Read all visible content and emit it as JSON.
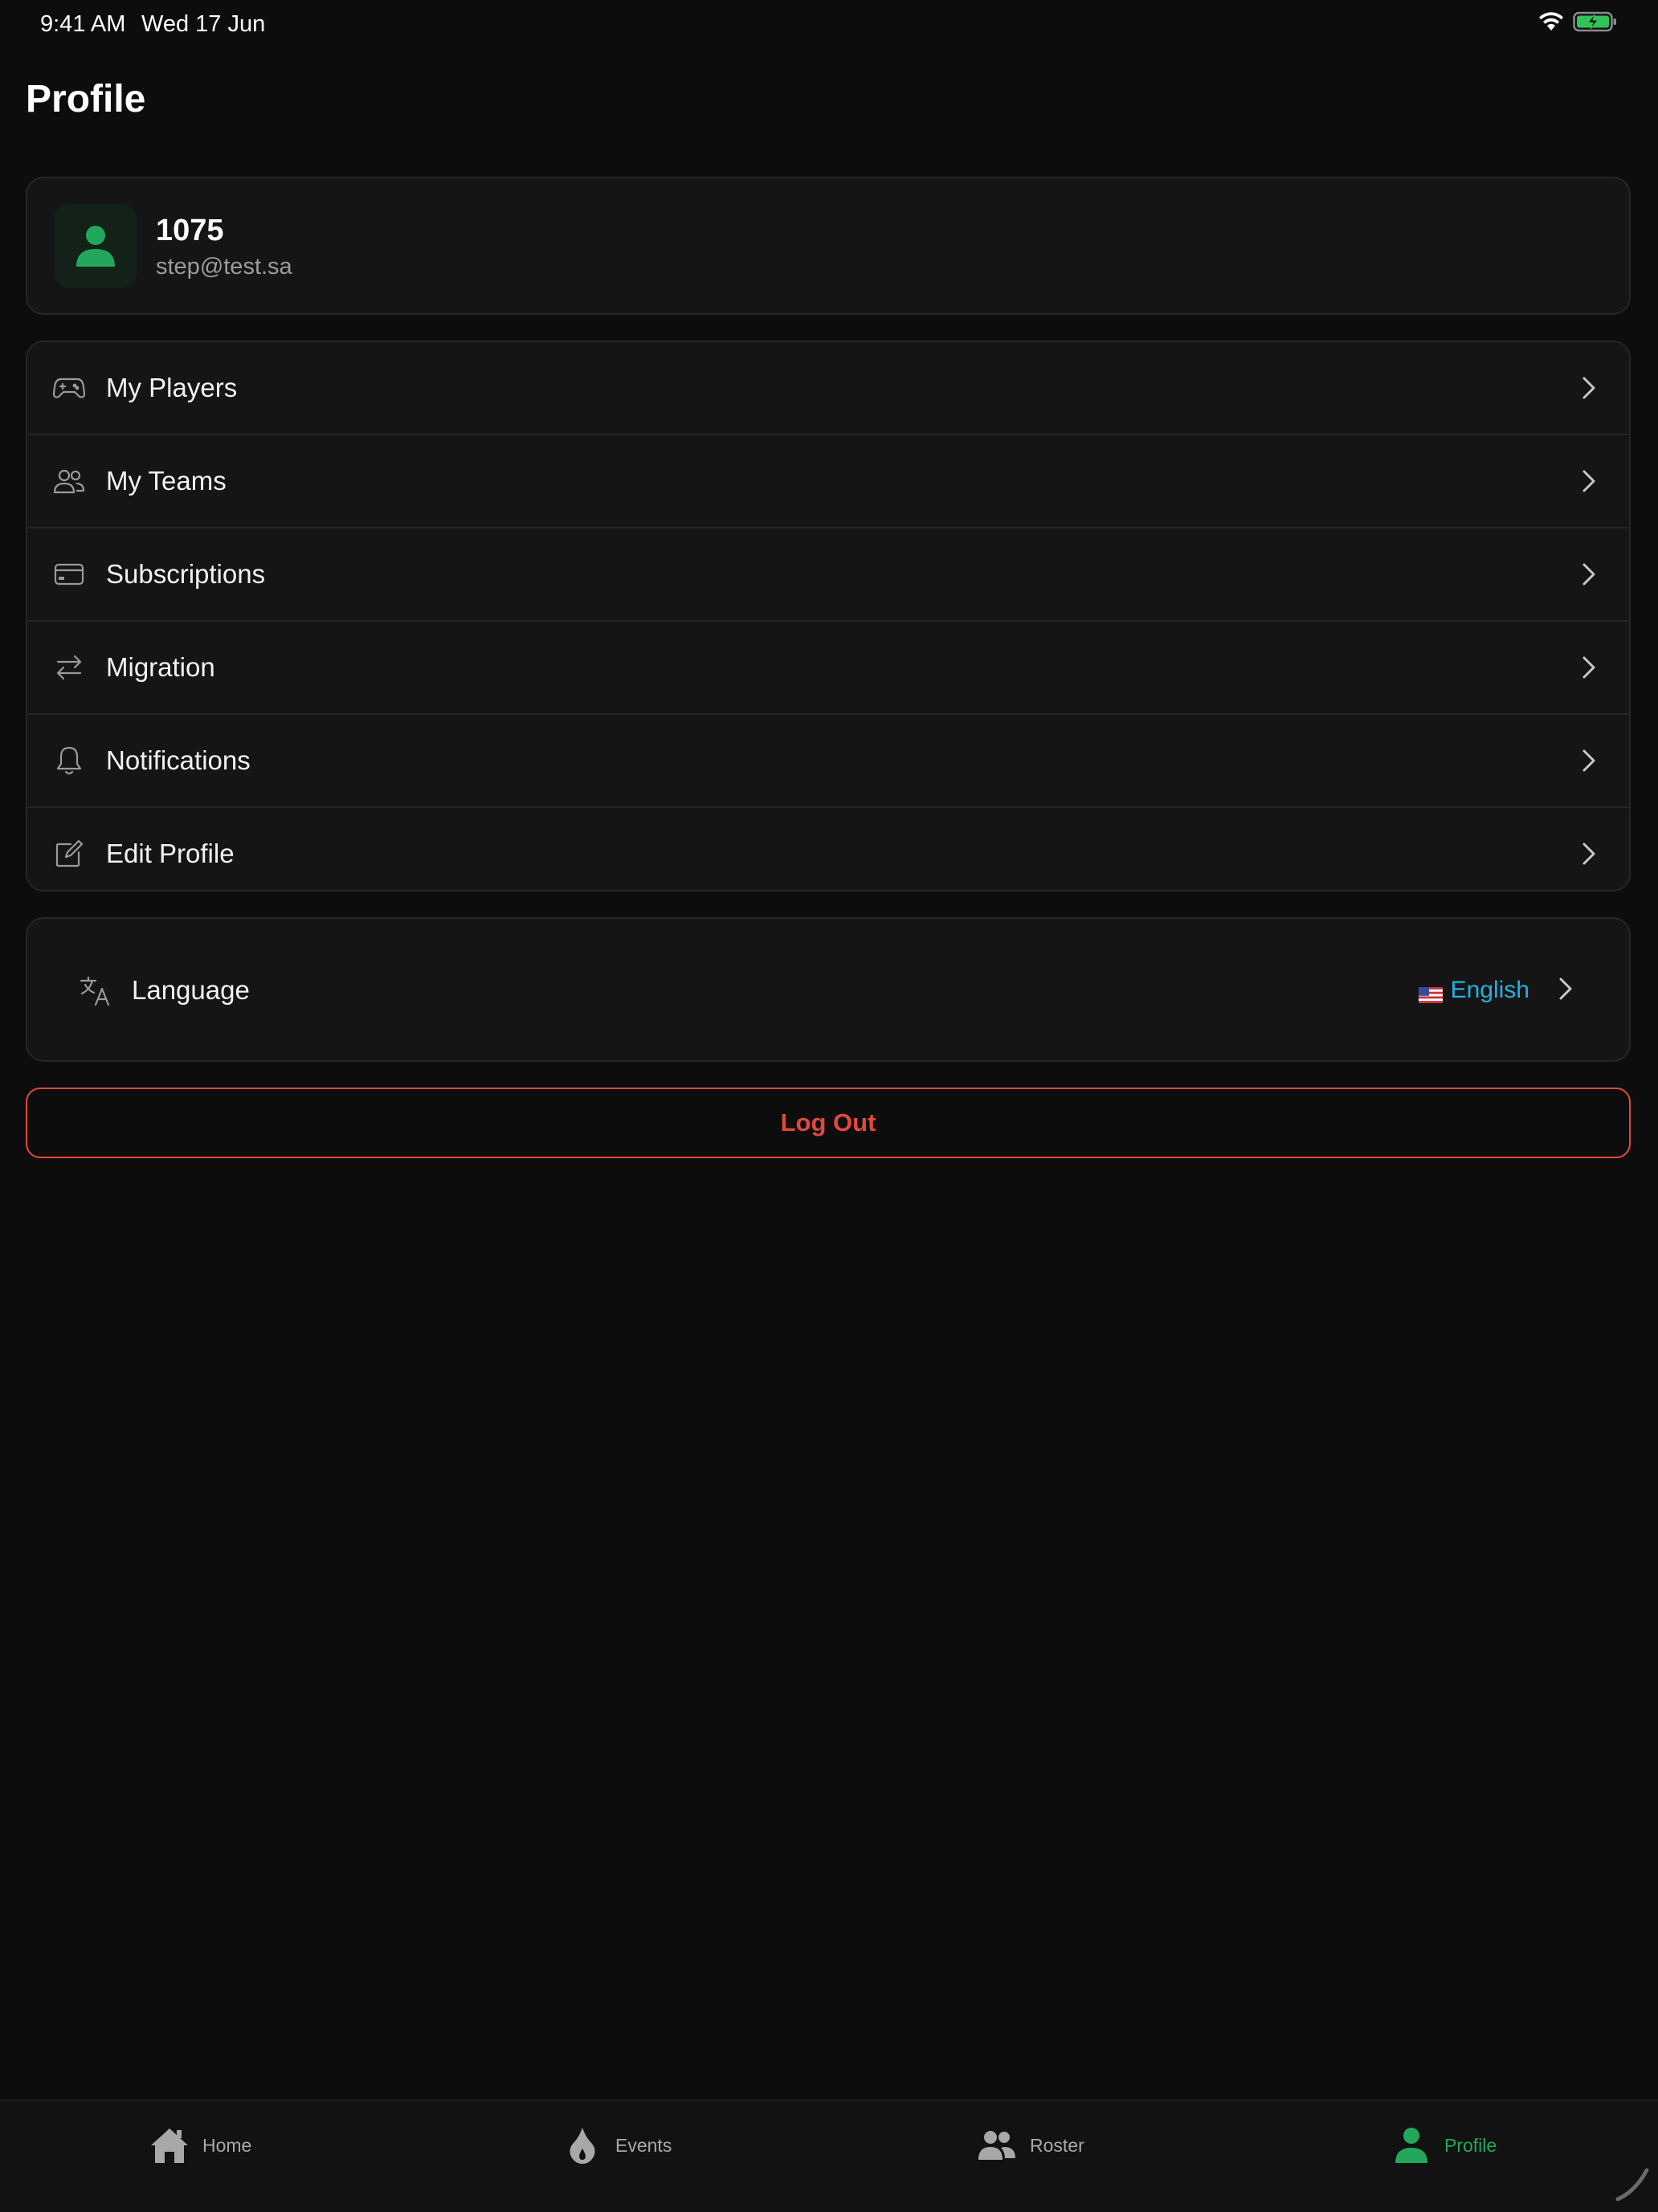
{
  "status_bar": {
    "time": "9:41 AM",
    "date": "Wed 17 Jun"
  },
  "header": {
    "title": "Profile"
  },
  "user": {
    "name": "1075",
    "email": "step@test.sa"
  },
  "menu": {
    "items": [
      {
        "label": "My Players",
        "icon": "gamepad-icon"
      },
      {
        "label": "My Teams",
        "icon": "users-icon"
      },
      {
        "label": "Subscriptions",
        "icon": "credit-card-icon"
      },
      {
        "label": "Migration",
        "icon": "swap-arrows-icon"
      },
      {
        "label": "Notifications",
        "icon": "bell-icon"
      },
      {
        "label": "Edit Profile",
        "icon": "edit-icon"
      }
    ]
  },
  "language": {
    "label": "Language",
    "value": "English",
    "flag": "🇺🇸",
    "value_color": "#22b0e0"
  },
  "logout": {
    "label": "Log Out",
    "color": "#e04a3a"
  },
  "tabs": [
    {
      "label": "Home",
      "icon": "home-icon",
      "active": false
    },
    {
      "label": "Events",
      "icon": "flame-icon",
      "active": false
    },
    {
      "label": "Roster",
      "icon": "roster-icon",
      "active": false
    },
    {
      "label": "Profile",
      "icon": "person-icon",
      "active": true
    }
  ],
  "colors": {
    "accent": "#22a85a",
    "background": "#0d0d0d",
    "card": "#151515",
    "danger": "#e04a3a",
    "link": "#22b0e0"
  }
}
